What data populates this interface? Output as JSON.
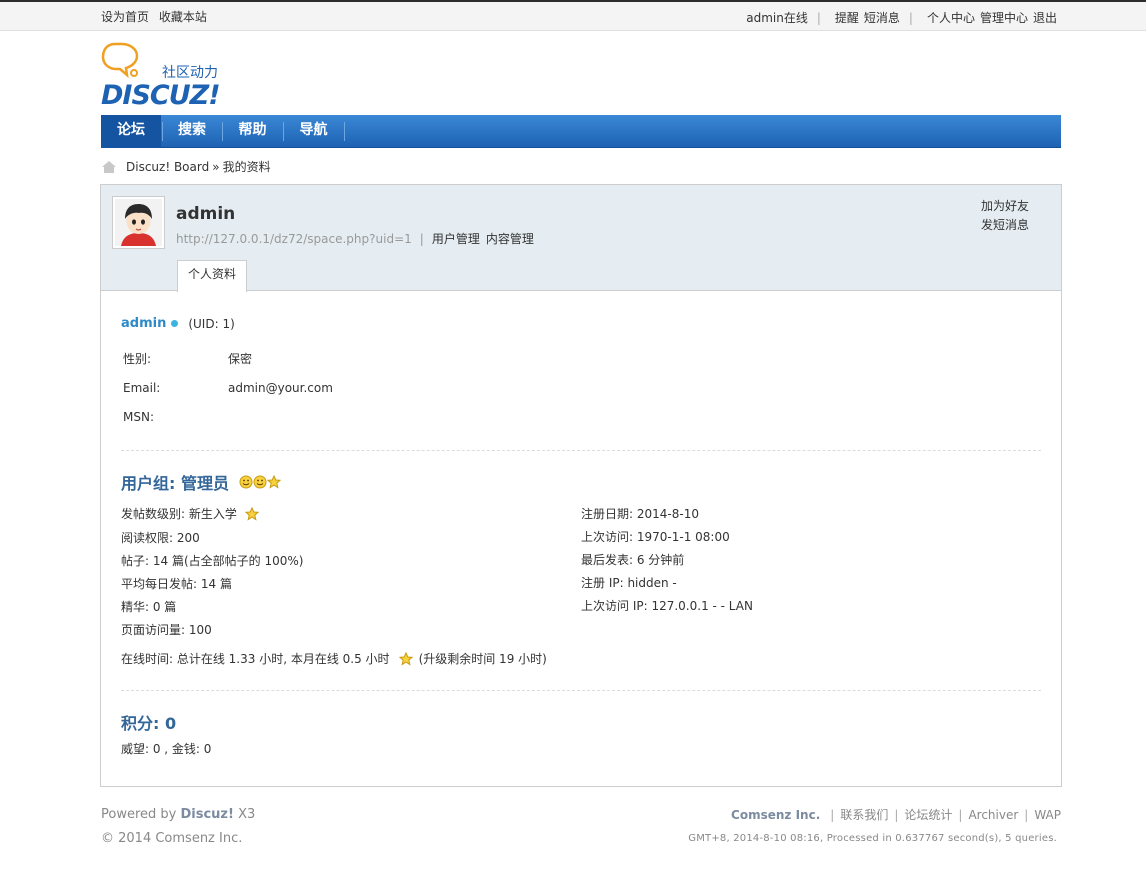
{
  "topbar": {
    "set_home": "设为首页",
    "bookmark": "收藏本站",
    "online_user": "admin在线",
    "remind": "提醒",
    "messages": "短消息",
    "user_center": "个人中心",
    "admin_center": "管理中心",
    "logout": "退出"
  },
  "logo": {
    "tagline": "社区动力",
    "brand": "DISCUZ!"
  },
  "nav": {
    "items": [
      "论坛",
      "搜索",
      "帮助",
      "导航"
    ]
  },
  "breadcrumb": {
    "board": "Discuz! Board",
    "sep": "»",
    "current": "我的资料"
  },
  "profile": {
    "username": "admin",
    "url": "http://127.0.0.1/dz72/space.php?uid=1",
    "sep": "|",
    "action_user_manage": "用户管理",
    "action_content_manage": "内容管理",
    "add_friend": "加为好友",
    "send_message": "发短消息",
    "tab": "个人资料",
    "uid_text": "(UID: 1)",
    "gender_label": "性别:",
    "gender_value": "保密",
    "email_label": "Email:",
    "email_value": "admin@your.com",
    "msn_label": "MSN:",
    "msn_value": ""
  },
  "group": {
    "title": "用户组: 管理员",
    "post_level": "发帖数级别: 新生入学",
    "read_perm": "阅读权限: 200",
    "posts": "帖子: 14 篇(占全部帖子的  100%)",
    "daily_posts": "平均每日发帖: 14 篇",
    "digest": "精华: 0 篇",
    "page_views": "页面访问量: 100",
    "online_time": "在线时间: 总计在线  1.33 小时, 本月在线  0.5 小时",
    "upgrade_time": "(升级剩余时间  19 小时)",
    "reg_date": "注册日期: 2014-8-10",
    "last_visit": "上次访问: 1970-1-1 08:00",
    "last_post": "最后发表: 6 分钟前",
    "reg_ip": "注册  IP: hidden -",
    "last_ip": "上次访问  IP: 127.0.0.1 - - LAN"
  },
  "credits": {
    "title": "积分: 0",
    "detail": "威望: 0 , 金钱: 0"
  },
  "footer": {
    "powered_prefix": "Powered by ",
    "powered_brand": "Discuz!",
    "powered_ver": " X3",
    "copyright": "© 2014 Comsenz Inc.",
    "company": "Comsenz Inc.",
    "links": [
      "联系我们",
      "论坛统计",
      "Archiver",
      "WAP"
    ],
    "stats": "GMT+8, 2014-8-10 08:16, Processed in 0.637767 second(s), 5 queries."
  },
  "colors": {
    "nav_blue": "#1e62b3",
    "link_blue": "#2e8bc8",
    "title_blue": "#336699",
    "head_bg": "#e5edf2"
  }
}
